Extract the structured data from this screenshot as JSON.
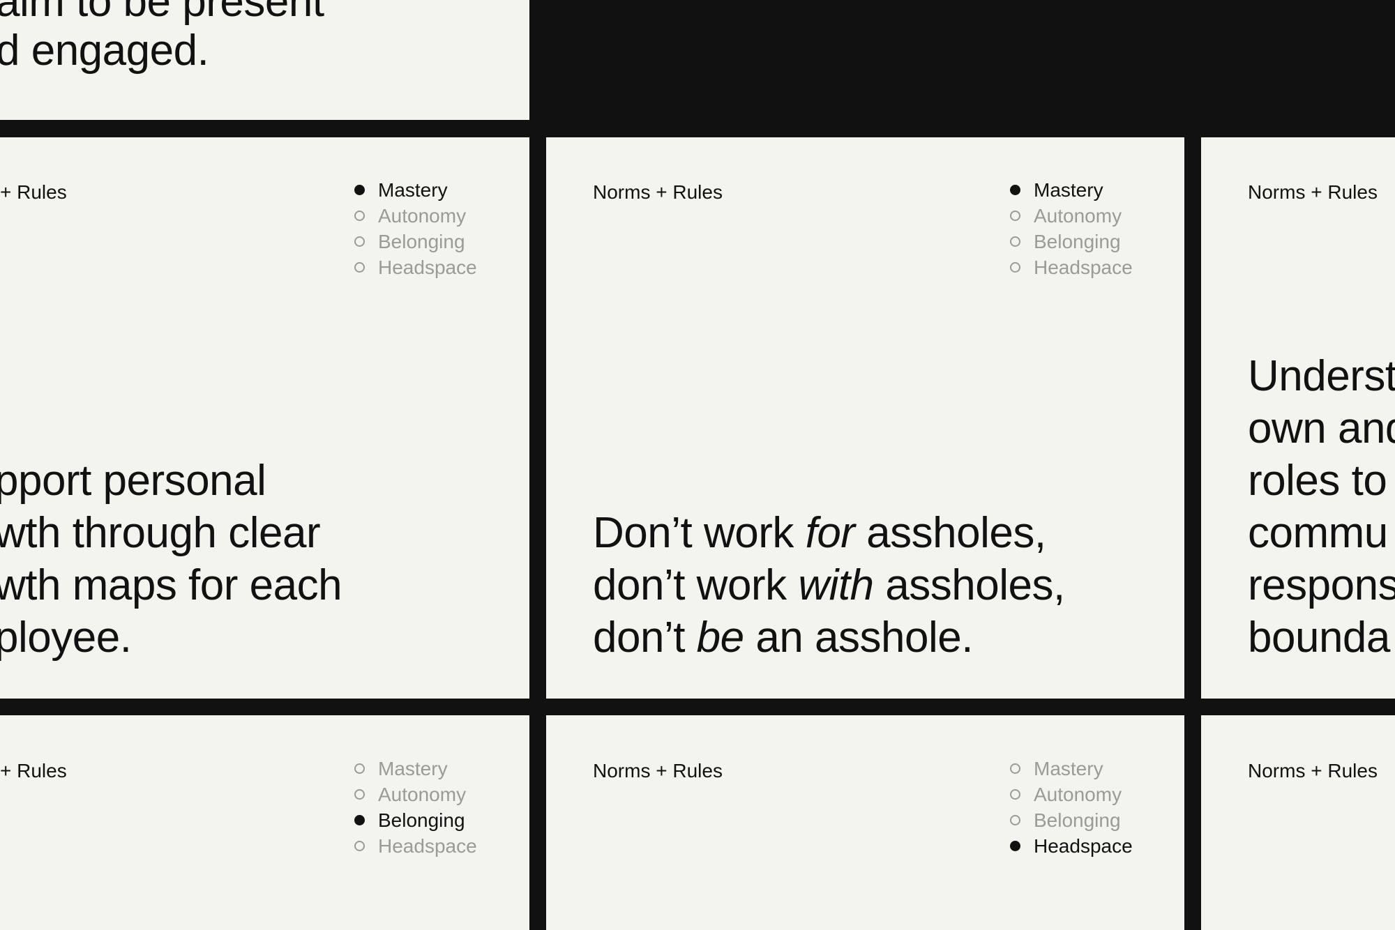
{
  "colors": {
    "background": "#111111",
    "card": "#f4f4ef",
    "text": "#111111",
    "muted": "#9a9a98"
  },
  "category_label": "Norms + Rules",
  "legend_options": [
    "Mastery",
    "Autonomy",
    "Belonging",
    "Headspace"
  ],
  "cards": [
    {
      "id": "top-left",
      "statement_lines": [
        "aim to be present",
        "d engaged."
      ]
    },
    {
      "id": "mid-left",
      "label": "+ Rules",
      "active": "Mastery",
      "statement_lines": [
        "pport personal",
        "wth through clear",
        "wth maps for each",
        "ployee."
      ]
    },
    {
      "id": "mid-center",
      "label": "Norms + Rules",
      "active": "Mastery",
      "statement_segments": [
        [
          "Don’t work ",
          "for",
          " assholes,"
        ],
        [
          "don’t work ",
          "with",
          " assholes,"
        ],
        [
          "don’t ",
          "be",
          " an asshole."
        ]
      ]
    },
    {
      "id": "mid-right",
      "label": "Norms + Rules",
      "statement_lines": [
        "Underst",
        "own and",
        "roles to",
        "commu",
        "respons",
        "bounda"
      ]
    },
    {
      "id": "bottom-left",
      "label": "+ Rules",
      "active": "Belonging"
    },
    {
      "id": "bottom-center",
      "label": "Norms + Rules",
      "active": "Headspace"
    },
    {
      "id": "bottom-right",
      "label": "Norms + Rules"
    }
  ]
}
